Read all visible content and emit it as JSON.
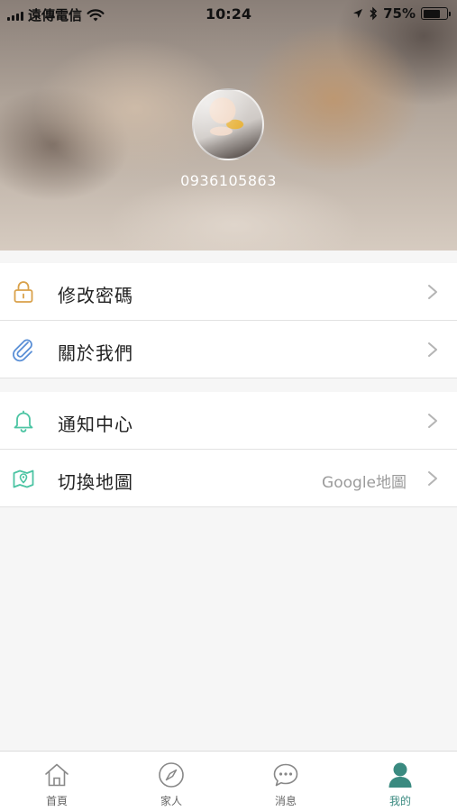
{
  "status_bar": {
    "carrier": "遠傳電信",
    "time": "10:24",
    "battery": "75%",
    "battery_level": 0.75
  },
  "profile": {
    "phone": "0936105863"
  },
  "menu": {
    "group1": [
      {
        "label": "修改密碼",
        "icon": "lock-icon"
      },
      {
        "label": "關於我們",
        "icon": "paperclip-icon"
      }
    ],
    "group2": [
      {
        "label": "通知中心",
        "icon": "bell-icon"
      },
      {
        "label": "切換地圖",
        "icon": "map-icon",
        "value": "Google地圖"
      }
    ]
  },
  "tabbar": {
    "tabs": [
      {
        "label": "首頁",
        "icon": "home-icon"
      },
      {
        "label": "家人",
        "icon": "compass-icon"
      },
      {
        "label": "消息",
        "icon": "chat-icon"
      },
      {
        "label": "我的",
        "icon": "person-icon",
        "active": true
      }
    ]
  },
  "colors": {
    "accent": "#3a8a80",
    "lock": "#d9a14a",
    "paperclip": "#5a8fd6",
    "bell": "#4cc4a3",
    "map": "#4cc4a3"
  }
}
